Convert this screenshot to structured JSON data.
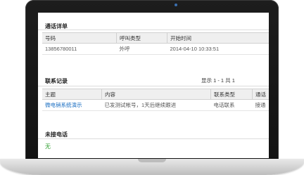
{
  "call_detail": {
    "title": "通话详单",
    "columns": [
      "号码",
      "呼叫类型",
      "开始时间"
    ],
    "rows": [
      [
        "13856780011",
        "外呼",
        "2014-04-10 10:33:51"
      ]
    ]
  },
  "contact_records": {
    "title": "联系记录",
    "pager": "显示 1 - 1 共 1",
    "columns": [
      "主题",
      "内容",
      "联系类型",
      "通话"
    ],
    "rows": [
      [
        "微电销系统演示",
        "已发测试帐号，1天后继续跟进",
        "电话联系",
        "接通"
      ]
    ]
  },
  "missed_calls": {
    "title": "未接电话",
    "value": "无"
  },
  "colors": {
    "link": "#1a6ec2",
    "none_value": "#2e9e2e"
  }
}
